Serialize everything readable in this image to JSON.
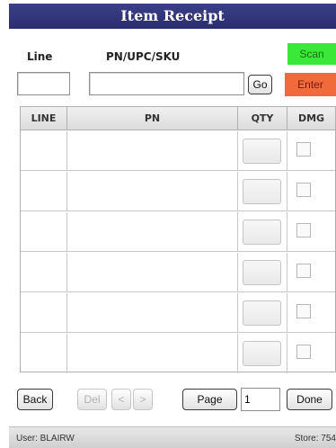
{
  "window": {
    "title": "Item Receipt"
  },
  "form": {
    "line_label": "Line",
    "pn_label": "PN/UPC/SKU",
    "line_value": "",
    "pn_value": "",
    "go_label": "Go",
    "scan_label": "Scan",
    "enter_label": "Enter"
  },
  "colors": {
    "title_bar": "#2f3278",
    "scan": "#3ae83a",
    "enter": "#f06a3c"
  },
  "table": {
    "columns": [
      "LINE",
      "PN",
      "QTY",
      "DMG"
    ],
    "rows": [
      {
        "line": "",
        "pn": "",
        "qty": "",
        "dmg": false
      },
      {
        "line": "",
        "pn": "",
        "qty": "",
        "dmg": false
      },
      {
        "line": "",
        "pn": "",
        "qty": "",
        "dmg": false
      },
      {
        "line": "",
        "pn": "",
        "qty": "",
        "dmg": false
      },
      {
        "line": "",
        "pn": "",
        "qty": "",
        "dmg": false
      },
      {
        "line": "",
        "pn": "",
        "qty": "",
        "dmg": false
      }
    ]
  },
  "footer": {
    "back_label": "Back",
    "del_label": "Del",
    "prev_label": "<",
    "next_label": ">",
    "page_label": "Page",
    "page_value": "1",
    "done_label": "Done"
  },
  "status": {
    "user": "User: BLAIRW",
    "store": "Store: 754"
  }
}
